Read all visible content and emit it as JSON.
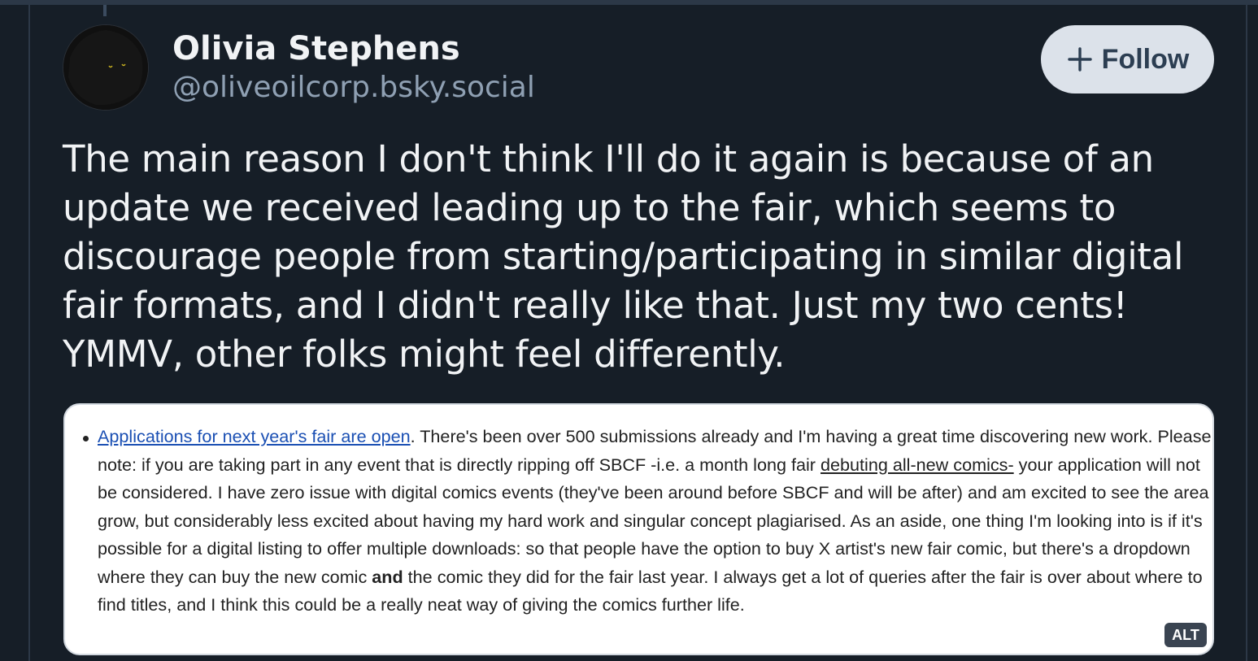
{
  "colors": {
    "background": "#161e27",
    "text_primary": "#f1f3f5",
    "text_secondary": "#8fa0b3",
    "follow_bg": "#dce2ea",
    "follow_text": "#2c3e52",
    "link": "#1a4fb3"
  },
  "author": {
    "display_name": "Olivia Stephens",
    "handle": "@oliveoilcorp.bsky.social",
    "avatar_icon": "avatar-image"
  },
  "follow_button": {
    "icon": "plus-icon",
    "label": "Follow"
  },
  "post": {
    "text": "The main reason I don't think I'll do it again is because of an update we received leading up to the fair, which seems to discourage people from starting/participating in similar digital fair formats, and I didn't really like that. Just my two cents! YMMV, other folks might feel differently."
  },
  "embed_image": {
    "link_text": "Applications for next year's fair are open",
    "text_part1": ". There's been over 500 submissions already and I'm having a great time discovering new work. Please note: if you are taking part in any event that is directly ripping off SBCF -i.e. a month long fair ",
    "underlined_text": "debuting all-new comics-",
    "text_part2": " your application will not be considered. I have zero issue with digital comics events (they've been around before SBCF and will be after) and am excited to see the area grow, but considerably less excited about having my hard work and singular concept plagiarised. As an aside, one thing I'm looking into is if it's possible for a digital listing to offer multiple downloads: so that people have the option to buy X artist's new fair comic, but there's a dropdown where they can buy the new comic ",
    "bold_text": "and",
    "text_part3": " the comic they did for the fair last year. I always get a lot of queries after the fair is over about where to find titles, and I think this could be a really neat way of giving the comics further life.",
    "alt_badge": "ALT"
  }
}
